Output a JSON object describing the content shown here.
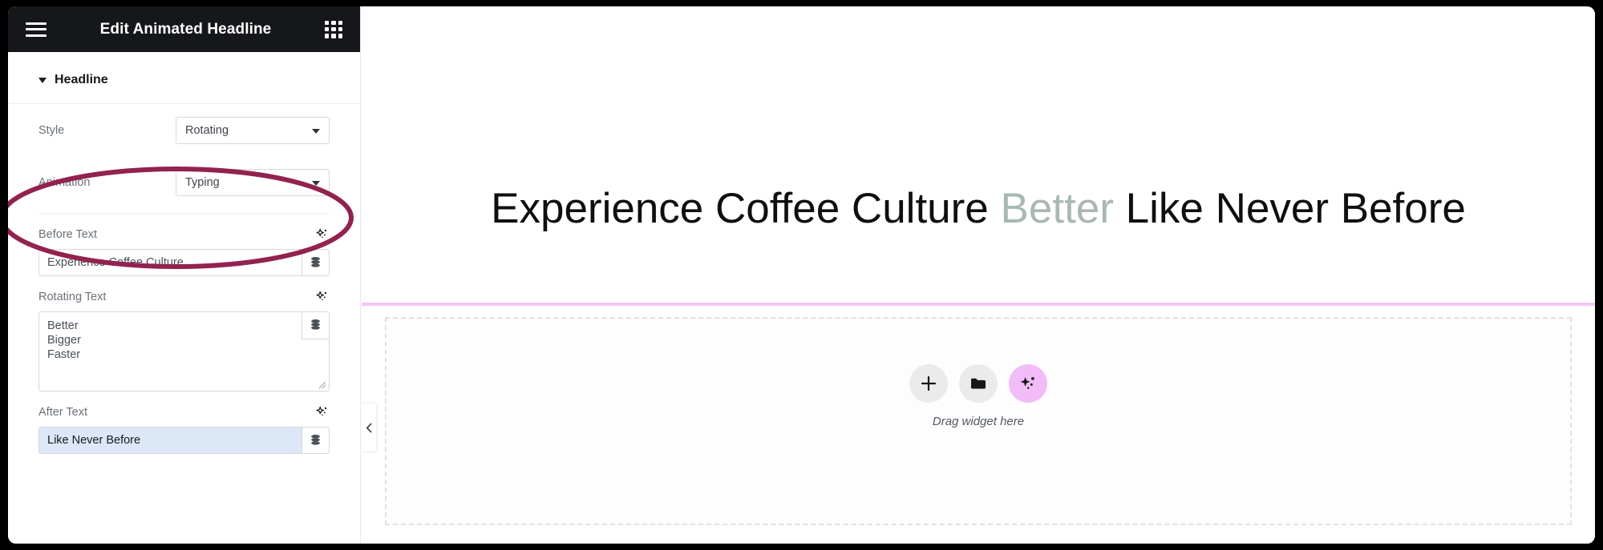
{
  "window": {
    "panel_title": "Edit Animated Headline",
    "menu_icon": "hamburger-icon",
    "apps_icon": "grid-apps-icon"
  },
  "panel": {
    "section": {
      "label": "Headline",
      "expanded": true,
      "caret_icon": "caret-down-icon"
    },
    "controls": [
      {
        "label": "Style",
        "value": "Rotating",
        "type": "select"
      },
      {
        "label": "Animation",
        "value": "Typing",
        "type": "select"
      }
    ],
    "fields": [
      {
        "label": "Before Text",
        "value": "Experience Coffee Culture",
        "type": "text",
        "selected": false,
        "ai_icon": "ai-sparkle-icon",
        "tag_icon": "dynamic-tags-database-icon"
      },
      {
        "label": "Rotating Text",
        "value": "Better\nBigger\nFaster",
        "type": "textarea",
        "selected": false,
        "ai_icon": "ai-sparkle-icon",
        "tag_icon": "dynamic-tags-database-icon"
      },
      {
        "label": "After Text",
        "value": "Like Never Before",
        "type": "text",
        "selected": true,
        "ai_icon": "ai-sparkle-icon",
        "tag_icon": "dynamic-tags-database-icon"
      }
    ],
    "collapse_icon": "chevron-left-icon"
  },
  "canvas": {
    "headline": {
      "before_text": "Experience Coffee Culture ",
      "rotating_text": "Better",
      "after_text": " Like Never Before"
    },
    "dropzone": {
      "hint": "Drag widget here",
      "buttons": [
        {
          "name": "add-element-button",
          "icon": "plus-icon"
        },
        {
          "name": "open-template-library-button",
          "icon": "folder-icon"
        },
        {
          "name": "ai-builder-button",
          "icon": "ai-sparkle-icon"
        }
      ]
    }
  },
  "annotation": {
    "shape": "ellipse",
    "targets": "Before Text field",
    "color": "#92224f"
  },
  "colors": {
    "header_bg": "#15171a",
    "accent_pink": "#f2c7f7",
    "ai_button": "#f1bcf7",
    "rotating_word": "#a9b8b1",
    "selected_input_bg": "#dce8f8",
    "annotation_stroke": "#92224f"
  }
}
